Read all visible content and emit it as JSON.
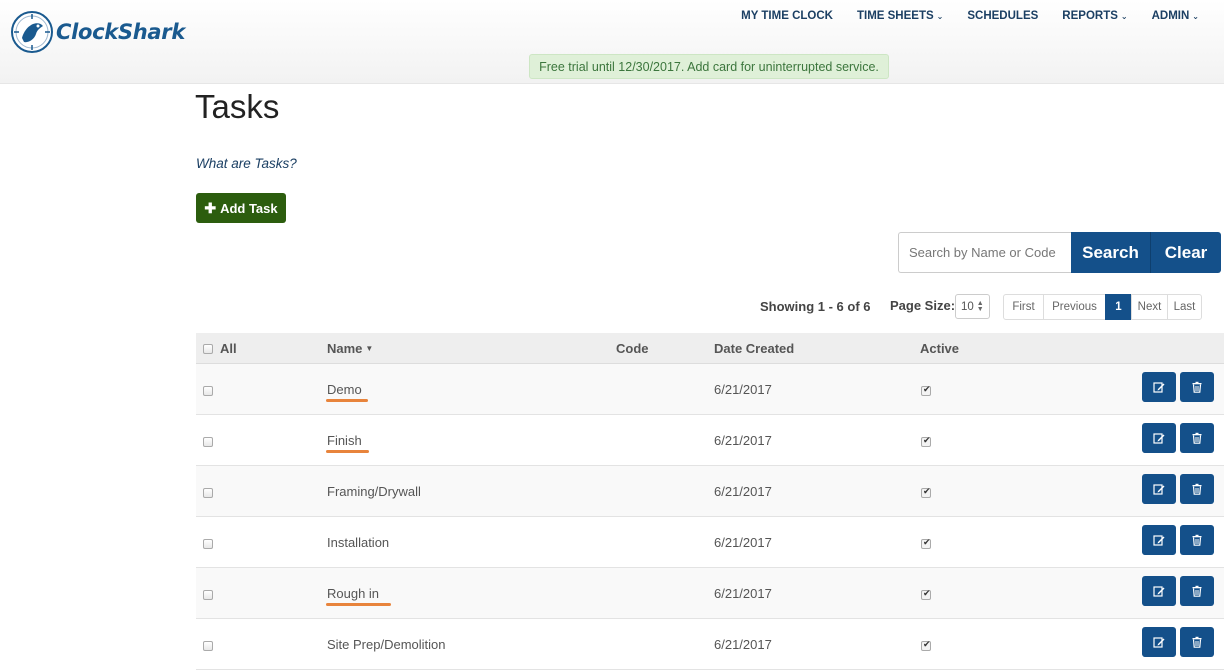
{
  "header": {
    "logo_text": "ClockShark",
    "nav": [
      {
        "label": "MY TIME CLOCK",
        "dropdown": false
      },
      {
        "label": "TIME SHEETS",
        "dropdown": true
      },
      {
        "label": "SCHEDULES",
        "dropdown": false
      },
      {
        "label": "REPORTS",
        "dropdown": true
      },
      {
        "label": "ADMIN",
        "dropdown": true
      }
    ],
    "trial_notice": "Free trial until 12/30/2017. Add card for uninterrupted service."
  },
  "page": {
    "title": "Tasks",
    "help_link": "What are Tasks?",
    "add_button": "Add Task"
  },
  "search": {
    "placeholder": "Search by Name or Code",
    "value": "",
    "search_label": "Search",
    "clear_label": "Clear"
  },
  "paging": {
    "showing": "Showing 1 - 6 of 6",
    "page_size_label": "Page Size:",
    "page_size": "10",
    "first": "First",
    "previous": "Previous",
    "current": "1",
    "next": "Next",
    "last": "Last"
  },
  "table": {
    "headers": {
      "all": "All",
      "name": "Name",
      "code": "Code",
      "date_created": "Date Created",
      "active": "Active"
    },
    "rows": [
      {
        "name": "Demo",
        "code": "",
        "date": "6/21/2017",
        "active": true,
        "highlighted": true
      },
      {
        "name": "Finish",
        "code": "",
        "date": "6/21/2017",
        "active": true,
        "highlighted": true
      },
      {
        "name": "Framing/Drywall",
        "code": "",
        "date": "6/21/2017",
        "active": true,
        "highlighted": false
      },
      {
        "name": "Installation",
        "code": "",
        "date": "6/21/2017",
        "active": true,
        "highlighted": false
      },
      {
        "name": "Rough in",
        "code": "",
        "date": "6/21/2017",
        "active": true,
        "highlighted": true
      },
      {
        "name": "Site Prep/Demolition",
        "code": "",
        "date": "6/21/2017",
        "active": true,
        "highlighted": false
      }
    ]
  },
  "colors": {
    "primary": "#14508a",
    "add_button": "#2c5d0e",
    "highlight_underline": "#e8843c",
    "trial_bg": "#dff0d8"
  }
}
